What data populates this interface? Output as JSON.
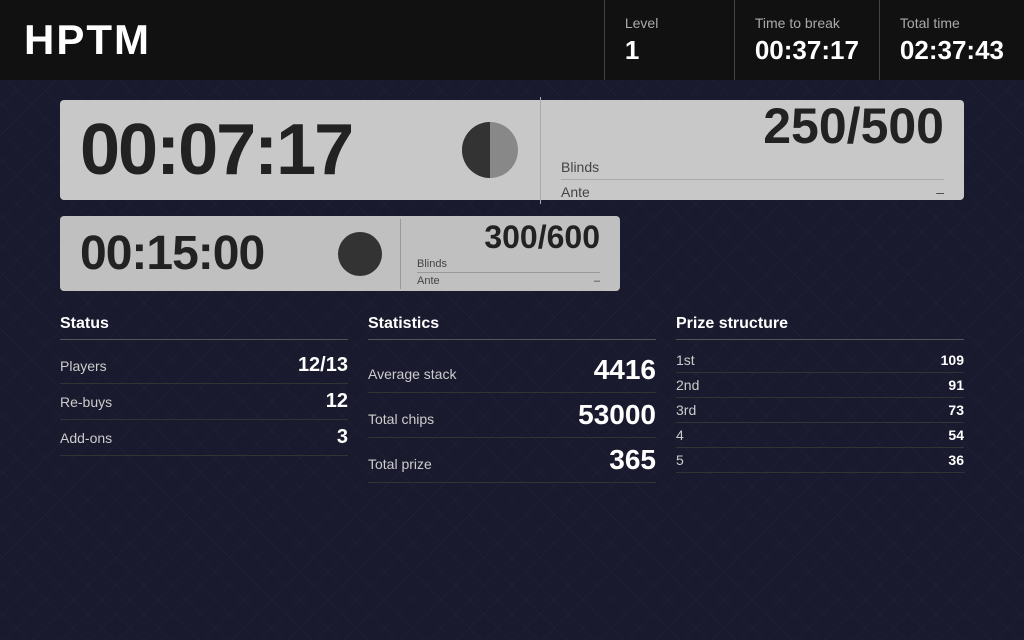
{
  "header": {
    "logo": "HPTM",
    "level_label": "Level",
    "level_value": "1",
    "time_to_break_label": "Time to break",
    "time_to_break_value": "00:37:17",
    "total_time_label": "Total time",
    "total_time_value": "02:37:43"
  },
  "primary_timer": {
    "time": "00:07:17",
    "blinds_label": "Blinds",
    "blinds_value": "250/500",
    "ante_label": "Ante",
    "ante_value": "–"
  },
  "secondary_timer": {
    "time": "00:15:00",
    "blinds_label": "Blinds",
    "blinds_value": "300/600",
    "ante_label": "Ante",
    "ante_value": "–"
  },
  "status": {
    "title": "Status",
    "players_label": "Players",
    "players_value": "12/13",
    "rebuys_label": "Re-buys",
    "rebuys_value": "12",
    "addons_label": "Add-ons",
    "addons_value": "3"
  },
  "statistics": {
    "title": "Statistics",
    "avg_stack_label": "Average stack",
    "avg_stack_value": "4416",
    "total_chips_label": "Total chips",
    "total_chips_value": "53000",
    "total_prize_label": "Total prize",
    "total_prize_value": "365"
  },
  "prize_structure": {
    "title": "Prize structure",
    "entries": [
      {
        "place": "1st",
        "value": "109"
      },
      {
        "place": "2nd",
        "value": "91"
      },
      {
        "place": "3rd",
        "value": "73"
      },
      {
        "place": "4",
        "value": "54"
      },
      {
        "place": "5",
        "value": "36"
      }
    ]
  }
}
